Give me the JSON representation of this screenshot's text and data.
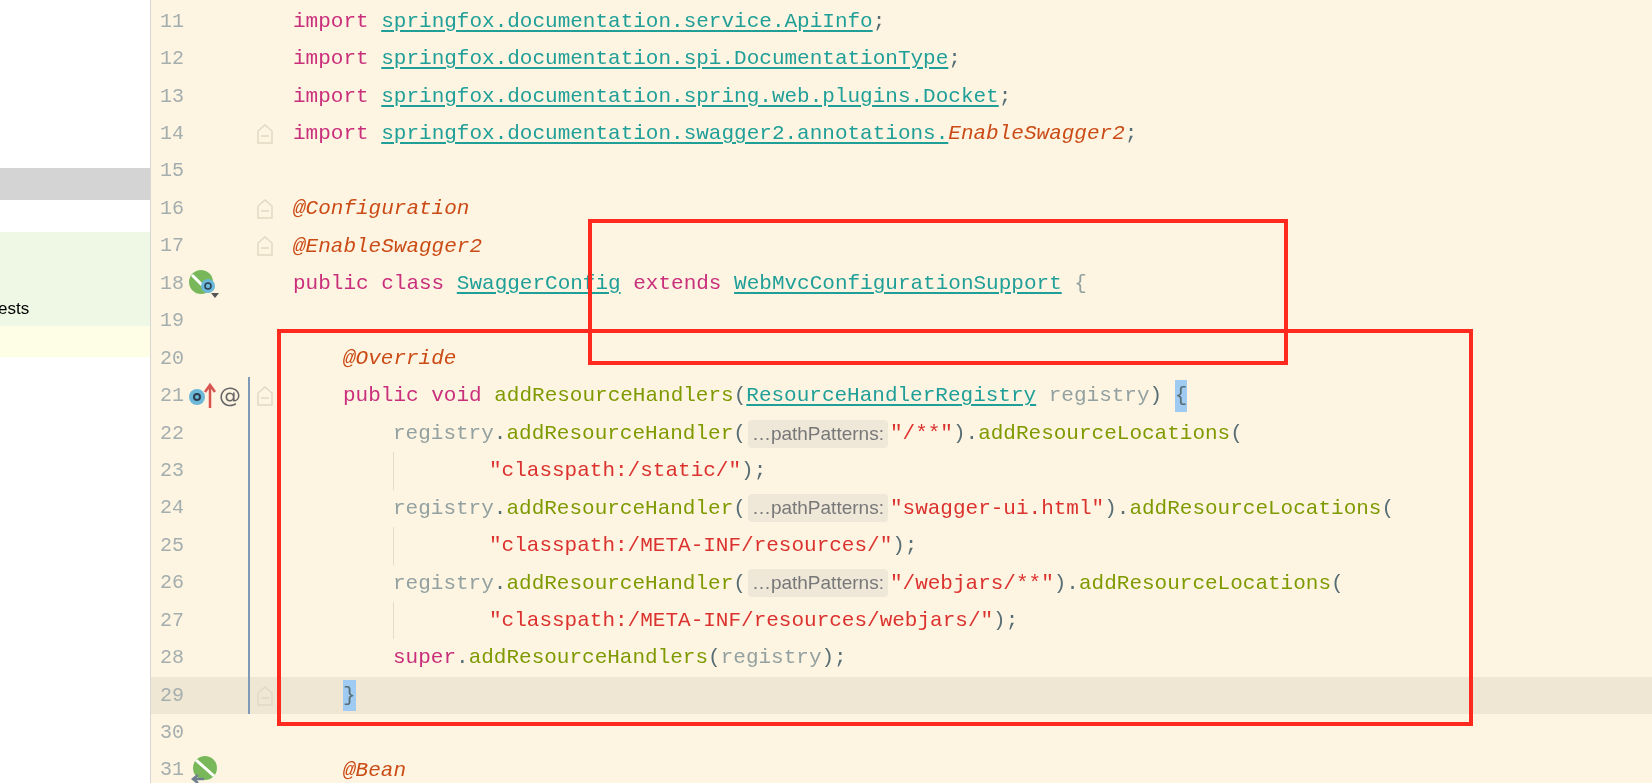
{
  "left_panel": {
    "items": [
      {
        "label": "ests"
      }
    ]
  },
  "editor": {
    "lines": [
      {
        "number": "11",
        "tokens": [
          {
            "kind": "keyword",
            "text": "import "
          },
          {
            "kind": "link",
            "text": "springfox.documentation.service.ApiInfo"
          },
          {
            "kind": "plain",
            "text": ";"
          }
        ]
      },
      {
        "number": "12",
        "tokens": [
          {
            "kind": "keyword",
            "text": "import "
          },
          {
            "kind": "link",
            "text": "springfox.documentation.spi.DocumentationType"
          },
          {
            "kind": "plain",
            "text": ";"
          }
        ]
      },
      {
        "number": "13",
        "tokens": [
          {
            "kind": "keyword",
            "text": "import "
          },
          {
            "kind": "link",
            "text": "springfox.documentation.spring.web.plugins.Docket"
          },
          {
            "kind": "plain",
            "text": ";"
          }
        ]
      },
      {
        "number": "14",
        "fold": true,
        "tokens": [
          {
            "kind": "keyword",
            "text": "import "
          },
          {
            "kind": "link",
            "text": "springfox.documentation.swagger2.annotations."
          },
          {
            "kind": "annotation",
            "text": "EnableSwagger2"
          },
          {
            "kind": "plain",
            "text": ";"
          }
        ]
      },
      {
        "number": "15"
      },
      {
        "number": "16",
        "fold": true,
        "tokens": [
          {
            "kind": "annotation",
            "text": "@Configuration"
          }
        ]
      },
      {
        "number": "17",
        "fold": true,
        "tokens": [
          {
            "kind": "annotation",
            "text": "@EnableSwagger2"
          }
        ]
      },
      {
        "number": "18",
        "gutter_icon": {
          "kind": "class"
        },
        "tokens": [
          {
            "kind": "keyword",
            "text": "public class "
          },
          {
            "kind": "link",
            "text": "SwaggerConfig"
          },
          {
            "kind": "keyword",
            "text": " extends "
          },
          {
            "kind": "link",
            "text": "WebMvcConfigurationSupport"
          },
          {
            "kind": "param",
            "text": " {"
          }
        ]
      },
      {
        "number": "19"
      },
      {
        "number": "20",
        "indent": {
          "kind": "member"
        },
        "tokens": [
          {
            "kind": "annotation",
            "text": "@Override"
          }
        ]
      },
      {
        "number": "21",
        "gutter_icon": {
          "kind": "override"
        },
        "gutter_text": "@",
        "fold": true,
        "scope": true,
        "indent": {
          "kind": "member"
        },
        "tokens": [
          {
            "kind": "keyword",
            "text": "public void "
          },
          {
            "kind": "method",
            "text": "addResourceHandlers"
          },
          {
            "kind": "plain",
            "text": "("
          },
          {
            "kind": "link",
            "text": "ResourceHandlerRegistry"
          },
          {
            "kind": "param",
            "text": " registry"
          },
          {
            "kind": "plain",
            "text": ") "
          },
          {
            "kind": "brace",
            "text": "{"
          }
        ]
      },
      {
        "number": "22",
        "scope": true,
        "indent": {
          "kind": "statement"
        },
        "tokens": [
          {
            "kind": "param",
            "text": "registry"
          },
          {
            "kind": "plain",
            "text": "."
          },
          {
            "kind": "method",
            "text": "addResourceHandler"
          },
          {
            "kind": "plain",
            "text": "("
          },
          {
            "kind": "hint",
            "text": "…pathPatterns:"
          },
          {
            "kind": "string",
            "text": "\"/**\""
          },
          {
            "kind": "plain",
            "text": ")."
          },
          {
            "kind": "method",
            "text": "addResourceLocations"
          },
          {
            "kind": "plain",
            "text": "("
          }
        ]
      },
      {
        "number": "23",
        "scope": true,
        "guide": true,
        "indent": {
          "kind": "continuation"
        },
        "tokens": [
          {
            "kind": "string",
            "text": "\"classpath:/static/\""
          },
          {
            "kind": "plain",
            "text": ");"
          }
        ]
      },
      {
        "number": "24",
        "scope": true,
        "indent": {
          "kind": "statement"
        },
        "tokens": [
          {
            "kind": "param",
            "text": "registry"
          },
          {
            "kind": "plain",
            "text": "."
          },
          {
            "kind": "method",
            "text": "addResourceHandler"
          },
          {
            "kind": "plain",
            "text": "("
          },
          {
            "kind": "hint",
            "text": "…pathPatterns:"
          },
          {
            "kind": "string",
            "text": "\"swagger-ui.html\""
          },
          {
            "kind": "plain",
            "text": ")."
          },
          {
            "kind": "method",
            "text": "addResourceLocations"
          },
          {
            "kind": "plain",
            "text": "("
          }
        ]
      },
      {
        "number": "25",
        "scope": true,
        "guide": true,
        "indent": {
          "kind": "continuation"
        },
        "tokens": [
          {
            "kind": "string",
            "text": "\"classpath:/META-INF/resources/\""
          },
          {
            "kind": "plain",
            "text": ");"
          }
        ]
      },
      {
        "number": "26",
        "scope": true,
        "indent": {
          "kind": "statement"
        },
        "tokens": [
          {
            "kind": "param",
            "text": "registry"
          },
          {
            "kind": "plain",
            "text": "."
          },
          {
            "kind": "method",
            "text": "addResourceHandler"
          },
          {
            "kind": "plain",
            "text": "("
          },
          {
            "kind": "hint",
            "text": "…pathPatterns:"
          },
          {
            "kind": "string",
            "text": "\"/webjars/**\""
          },
          {
            "kind": "plain",
            "text": ")."
          },
          {
            "kind": "method",
            "text": "addResourceLocations"
          },
          {
            "kind": "plain",
            "text": "("
          }
        ]
      },
      {
        "number": "27",
        "scope": true,
        "guide": true,
        "indent": {
          "kind": "continuation"
        },
        "tokens": [
          {
            "kind": "string",
            "text": "\"classpath:/META-INF/resources/webjars/\""
          },
          {
            "kind": "plain",
            "text": ");"
          }
        ]
      },
      {
        "number": "28",
        "scope": true,
        "indent": {
          "kind": "statement"
        },
        "tokens": [
          {
            "kind": "keyword",
            "text": "super"
          },
          {
            "kind": "plain",
            "text": "."
          },
          {
            "kind": "method",
            "text": "addResourceHandlers"
          },
          {
            "kind": "plain",
            "text": "("
          },
          {
            "kind": "param",
            "text": "registry"
          },
          {
            "kind": "plain",
            "text": ");"
          }
        ]
      },
      {
        "number": "29",
        "current": true,
        "scope": true,
        "fold": true,
        "indent": {
          "kind": "member"
        },
        "tokens": [
          {
            "kind": "brace",
            "text": "}"
          }
        ]
      },
      {
        "number": "30"
      },
      {
        "number": "31",
        "gutter_icon": {
          "kind": "bean"
        },
        "indent": {
          "kind": "member"
        },
        "tokens": [
          {
            "kind": "annotation",
            "text": "@Bean"
          }
        ]
      }
    ]
  }
}
